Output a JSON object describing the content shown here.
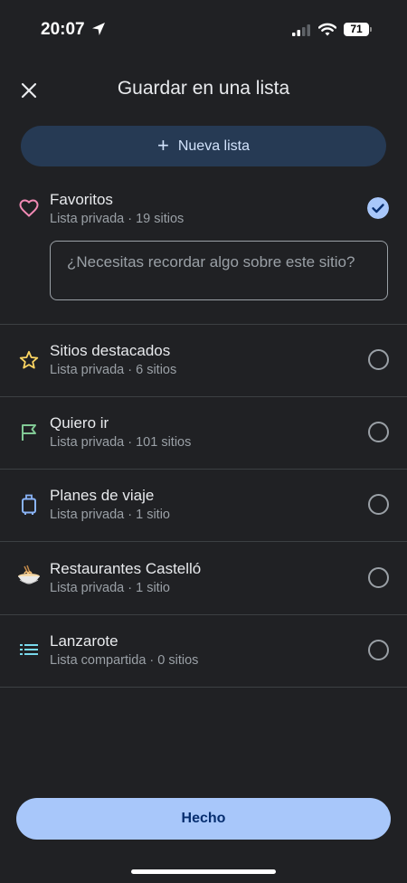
{
  "status_bar": {
    "time": "20:07",
    "battery": "71"
  },
  "header": {
    "title": "Guardar en una lista"
  },
  "new_list_button": {
    "label": "Nueva lista"
  },
  "note_field": {
    "placeholder": "¿Necesitas recordar algo sobre este sitio?"
  },
  "lists": [
    {
      "title": "Favoritos",
      "subtitle": "Lista privada · 19 sitios",
      "icon": "heart-icon",
      "icon_color": "#f28ab5",
      "selected": true
    },
    {
      "title": "Sitios destacados",
      "subtitle": "Lista privada · 6 sitios",
      "icon": "star-icon",
      "icon_color": "#fdd663",
      "selected": false
    },
    {
      "title": "Quiero ir",
      "subtitle": "Lista privada · 101 sitios",
      "icon": "flag-icon",
      "icon_color": "#81c995",
      "selected": false
    },
    {
      "title": "Planes de viaje",
      "subtitle": "Lista privada · 1 sitio",
      "icon": "suitcase-icon",
      "icon_color": "#8ab4f8",
      "selected": false
    },
    {
      "title": "Restaurantes Castelló",
      "subtitle": "Lista privada · 1 sitio",
      "icon": "noodle-bowl-icon",
      "icon_color": "#f5c27a",
      "selected": false
    },
    {
      "title": "Lanzarote",
      "subtitle": "Lista compartida · 0 sitios",
      "icon": "list-icon",
      "icon_color": "#78d9ec",
      "selected": false
    }
  ],
  "done_button": {
    "label": "Hecho"
  },
  "colors": {
    "background": "#202124",
    "accent": "#a8c7fa",
    "new_list_bg": "#263a54"
  }
}
